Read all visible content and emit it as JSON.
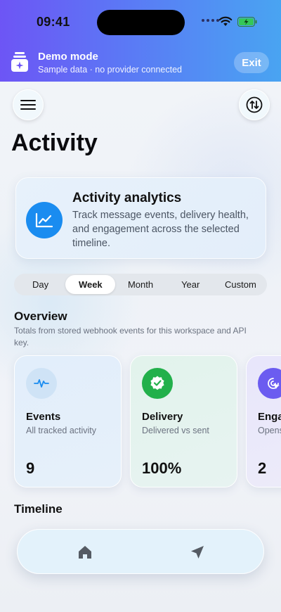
{
  "status_bar": {
    "time": "09:41"
  },
  "banner": {
    "title": "Demo mode",
    "subtitle": "Sample data · no provider connected",
    "exit_label": "Exit",
    "icon": "sparkle-box-icon"
  },
  "header": {
    "menu_icon": "hamburger-menu-icon",
    "sort_icon": "sort-arrows-icon",
    "title": "Activity"
  },
  "analytics_card": {
    "icon": "line-chart-icon",
    "title": "Activity analytics",
    "description": "Track message events, delivery health, and engagement across the selected timeline."
  },
  "segments": {
    "items": [
      "Day",
      "Week",
      "Month",
      "Year",
      "Custom"
    ],
    "selected": "Week"
  },
  "overview": {
    "title": "Overview",
    "subtitle": "Totals from stored webhook events for this workspace and API key."
  },
  "metrics": [
    {
      "icon": "pulse-icon",
      "title": "Events",
      "subtitle": "All tracked activity",
      "value": "9"
    },
    {
      "icon": "check-badge-icon",
      "title": "Delivery",
      "subtitle": "Delivered vs sent",
      "value": "100%"
    },
    {
      "icon": "cursor-click-icon",
      "title": "Enga",
      "subtitle": "Opens",
      "value": "2"
    }
  ],
  "timeline": {
    "title": "Timeline"
  },
  "tabbar": {
    "items": [
      "home-icon",
      "send-icon"
    ]
  },
  "colors": {
    "accent_blue": "#1a8cf0",
    "delivery_green": "#22b04b",
    "engagement_purple": "#6b5cf0"
  }
}
